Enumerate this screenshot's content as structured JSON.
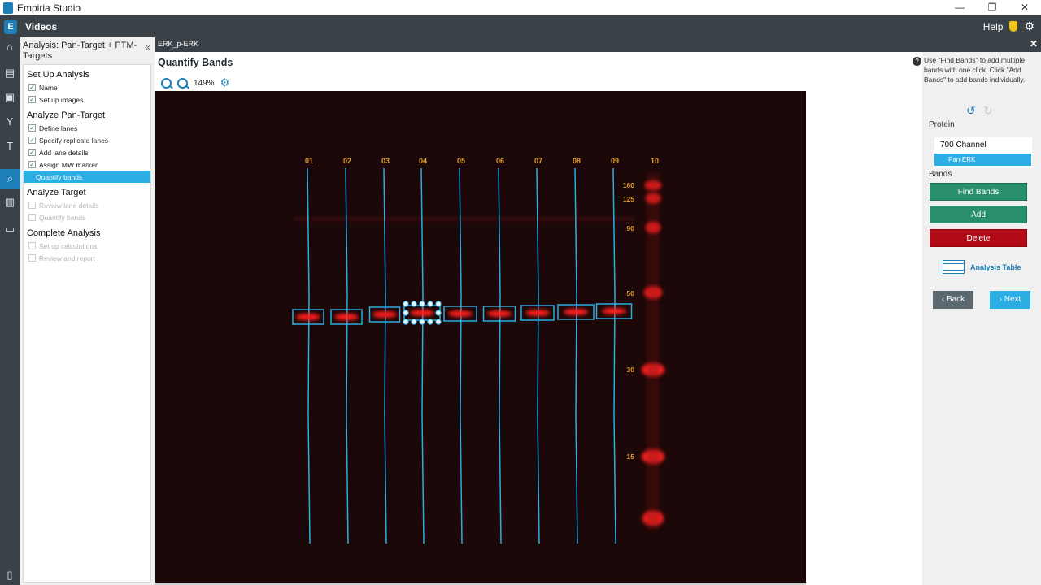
{
  "window": {
    "title": "Empiria Studio",
    "controls": [
      "—",
      "❐",
      "✕"
    ]
  },
  "topnav": {
    "app_icon": "E",
    "section": "Videos",
    "help": "Help",
    "icons": [
      "shield-icon",
      "gear-icon"
    ]
  },
  "rail_icons": [
    "home-icon",
    "document-icon",
    "image-icon",
    "antibody-icon",
    "text-icon",
    "analysis-icon",
    "chart-icon",
    "archive-icon",
    "trash-icon"
  ],
  "steps": {
    "header": "Analysis: Pan-Target + PTM-Targets",
    "collapse_glyph": "«",
    "sections": [
      {
        "title": "Set Up Analysis",
        "items": [
          {
            "label": "Name",
            "state": "done"
          },
          {
            "label": "Set up images",
            "state": "done"
          }
        ]
      },
      {
        "title": "Analyze Pan-Target",
        "items": [
          {
            "label": "Define lanes",
            "state": "done"
          },
          {
            "label": "Specify replicate lanes",
            "state": "done"
          },
          {
            "label": "Add lane details",
            "state": "done"
          },
          {
            "label": "Assign MW marker",
            "state": "done"
          },
          {
            "label": "Quantify bands",
            "state": "selected"
          }
        ]
      },
      {
        "title": "Analyze Target",
        "items": [
          {
            "label": "Review lane details",
            "state": "disabled"
          },
          {
            "label": "Quantify bands",
            "state": "disabled"
          }
        ]
      },
      {
        "title": "Complete Analysis",
        "items": [
          {
            "label": "Set up calculations",
            "state": "disabled"
          },
          {
            "label": "Review and report",
            "state": "disabled"
          }
        ]
      }
    ]
  },
  "tab": {
    "name": "ERK_p-ERK",
    "close": "✕"
  },
  "main": {
    "title": "Quantify Bands",
    "zoom": "149%"
  },
  "gel": {
    "lanes": [
      "01",
      "02",
      "03",
      "04",
      "05",
      "06",
      "07",
      "08",
      "09",
      "10"
    ],
    "marker_labels": [
      "160",
      "125",
      "90",
      "50",
      "30",
      "15"
    ],
    "selected_lane": "04"
  },
  "right": {
    "help": "Use \"Find Bands\" to add multiple bands with one click. Click \"Add Bands\" to add bands individually.",
    "protein_label": "Protein",
    "channel": "700 Channel",
    "target": "Pan-ERK",
    "bands_label": "Bands",
    "find_bands": "Find Bands",
    "add": "Add",
    "delete": "Delete",
    "analysis_table": "Analysis Table",
    "back": "Back",
    "next": "Next",
    "colors": {
      "green": "#2a8f6f",
      "red": "#b10c16",
      "accent": "#2aaee3"
    }
  }
}
